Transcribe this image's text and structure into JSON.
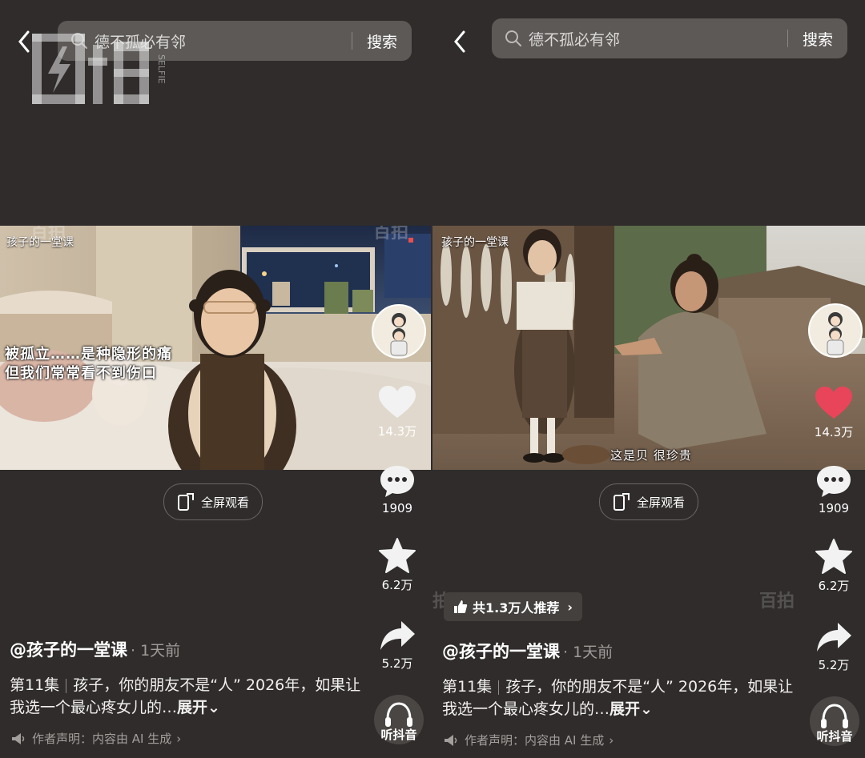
{
  "panels": [
    {
      "search": {
        "query": "德不孤必有邻",
        "button": "搜索"
      },
      "video": {
        "tag": "孩子的一堂课",
        "subtitle_line1": "被孤立……是种隐形的痛",
        "subtitle_line2": "但我们常常看不到伤口"
      },
      "fullscreen_label": "全屏观看",
      "rail": {
        "likes": "14.3万",
        "comments": "1909",
        "favorites": "6.2万",
        "shares": "5.2万",
        "listen": "听抖音"
      },
      "author": "@孩子的一堂课",
      "time": "· 1天前",
      "episode": "第11集",
      "description": "孩子，你的朋友不是“人” 2026年，如果让我选一个最心疼女儿的…",
      "more": "展开",
      "declaration": "作者声明：内容由 AI 生成",
      "liked": false
    },
    {
      "search": {
        "query": "德不孤必有邻",
        "button": "搜索"
      },
      "video": {
        "tag": "孩子的一堂课",
        "subtitle": "这是贝 很珍贵"
      },
      "fullscreen_label": "全屏观看",
      "rail": {
        "likes": "14.3万",
        "comments": "1909",
        "favorites": "6.2万",
        "shares": "5.2万",
        "listen": "听抖音"
      },
      "recommend": "共1.3万人推荐",
      "author": "@孩子的一堂课",
      "time": "· 1天前",
      "episode": "第11集",
      "description": "孩子，你的朋友不是“人” 2026年，如果让我选一个最心疼女儿的…",
      "more": "展开",
      "declaration": "作者声明：内容由 AI 生成",
      "liked": true
    }
  ],
  "watermark": {
    "brand": "百拍",
    "sub": "SELFIE"
  },
  "colors": {
    "background": "#2f2c2b",
    "liked_heart": "#e8445a",
    "search_bg": "#5c5957"
  }
}
